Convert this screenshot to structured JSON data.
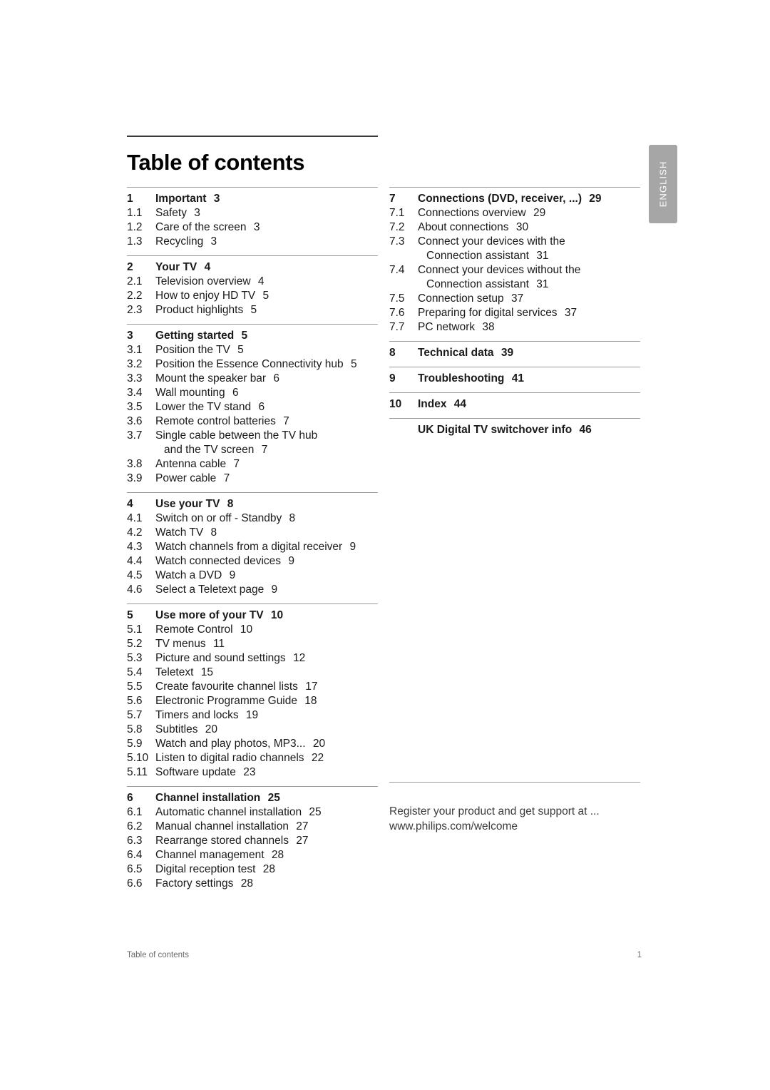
{
  "document": {
    "title": "Table of contents",
    "language_tab": "ENGLISH"
  },
  "footer": {
    "left": "Table of contents",
    "page_number": "1"
  },
  "register": {
    "line1": "Register your product and get support at ...",
    "line2": "www.philips.com/welcome"
  },
  "toc": {
    "left_column": [
      {
        "entries": [
          {
            "num": "1",
            "text": "Important",
            "page": "3",
            "head": true
          },
          {
            "num": "1.1",
            "text": "Safety",
            "page": "3"
          },
          {
            "num": "1.2",
            "text": "Care of the screen",
            "page": "3"
          },
          {
            "num": "1.3",
            "text": "Recycling",
            "page": "3"
          }
        ]
      },
      {
        "entries": [
          {
            "num": "2",
            "text": "Your TV",
            "page": "4",
            "head": true
          },
          {
            "num": "2.1",
            "text": "Television overview",
            "page": "4"
          },
          {
            "num": "2.2",
            "text": "How to enjoy HD TV",
            "page": "5"
          },
          {
            "num": "2.3",
            "text": "Product highlights",
            "page": "5"
          }
        ]
      },
      {
        "entries": [
          {
            "num": "3",
            "text": "Getting started",
            "page": "5",
            "head": true
          },
          {
            "num": "3.1",
            "text": "Position the TV",
            "page": "5"
          },
          {
            "num": "3.2",
            "text": "Position the Essence Connectivity hub",
            "page": "5"
          },
          {
            "num": "3.3",
            "text": "Mount the speaker bar",
            "page": "6"
          },
          {
            "num": "3.4",
            "text": "Wall mounting",
            "page": "6"
          },
          {
            "num": "3.5",
            "text": "Lower the TV stand",
            "page": "6"
          },
          {
            "num": "3.6",
            "text": "Remote control batteries",
            "page": "7"
          },
          {
            "num": "3.7",
            "text": "Single cable between the TV hub",
            "page": ""
          },
          {
            "num": "",
            "text": "and the TV screen",
            "page": "7",
            "cont": true
          },
          {
            "num": "3.8",
            "text": "Antenna cable",
            "page": "7"
          },
          {
            "num": "3.9",
            "text": "Power cable",
            "page": "7"
          }
        ]
      },
      {
        "entries": [
          {
            "num": "4",
            "text": "Use your TV",
            "page": "8",
            "head": true
          },
          {
            "num": "4.1",
            "text": "Switch on or off - Standby",
            "page": "8"
          },
          {
            "num": "4.2",
            "text": "Watch TV",
            "page": "8"
          },
          {
            "num": "4.3",
            "text": "Watch channels from a digital receiver",
            "page": "9"
          },
          {
            "num": "4.4",
            "text": "Watch connected devices",
            "page": "9"
          },
          {
            "num": "4.5",
            "text": "Watch a DVD",
            "page": "9"
          },
          {
            "num": "4.6",
            "text": "Select a Teletext page",
            "page": "9"
          }
        ]
      },
      {
        "entries": [
          {
            "num": "5",
            "text": "Use more of your TV",
            "page": "10",
            "head": true
          },
          {
            "num": "5.1",
            "text": "Remote Control",
            "page": "10"
          },
          {
            "num": "5.2",
            "text": "TV menus",
            "page": "11"
          },
          {
            "num": "5.3",
            "text": "Picture and sound settings",
            "page": "12"
          },
          {
            "num": "5.4",
            "text": "Teletext",
            "page": "15"
          },
          {
            "num": "5.5",
            "text": "Create favourite channel lists",
            "page": "17"
          },
          {
            "num": "5.6",
            "text": "Electronic Programme Guide",
            "page": "18"
          },
          {
            "num": "5.7",
            "text": "Timers and locks",
            "page": "19"
          },
          {
            "num": "5.8",
            "text": "Subtitles",
            "page": "20"
          },
          {
            "num": "5.9",
            "text": "Watch and play photos, MP3...",
            "page": "20"
          },
          {
            "num": "5.10",
            "text": "Listen to digital radio channels",
            "page": "22"
          },
          {
            "num": "5.11",
            "text": "Software update",
            "page": "23"
          }
        ]
      },
      {
        "entries": [
          {
            "num": "6",
            "text": "Channel installation",
            "page": "25",
            "head": true
          },
          {
            "num": "6.1",
            "text": "Automatic channel installation",
            "page": "25"
          },
          {
            "num": "6.2",
            "text": "Manual channel installation",
            "page": "27"
          },
          {
            "num": "6.3",
            "text": "Rearrange stored channels",
            "page": "27"
          },
          {
            "num": "6.4",
            "text": "Channel management",
            "page": "28"
          },
          {
            "num": "6.5",
            "text": "Digital reception test",
            "page": "28"
          },
          {
            "num": "6.6",
            "text": "Factory settings",
            "page": "28"
          }
        ]
      }
    ],
    "right_column": [
      {
        "entries": [
          {
            "num": "7",
            "text": "Connections (DVD, receiver, ...)",
            "page": "29",
            "head": true
          },
          {
            "num": "7.1",
            "text": "Connections overview",
            "page": "29"
          },
          {
            "num": "7.2",
            "text": "About connections",
            "page": "30"
          },
          {
            "num": "7.3",
            "text": "Connect your devices with the",
            "page": ""
          },
          {
            "num": "",
            "text": "Connection assistant",
            "page": "31",
            "cont": true
          },
          {
            "num": "7.4",
            "text": "Connect your devices without the",
            "page": ""
          },
          {
            "num": "",
            "text": "Connection assistant",
            "page": "31",
            "cont": true
          },
          {
            "num": "7.5",
            "text": "Connection setup",
            "page": "37"
          },
          {
            "num": "7.6",
            "text": "Preparing for digital services",
            "page": "37"
          },
          {
            "num": "7.7",
            "text": "PC network",
            "page": "38"
          }
        ]
      },
      {
        "entries": [
          {
            "num": "8",
            "text": "Technical data",
            "page": "39",
            "head": true
          }
        ]
      },
      {
        "entries": [
          {
            "num": "9",
            "text": "Troubleshooting",
            "page": "41",
            "head": true
          }
        ]
      },
      {
        "entries": [
          {
            "num": "10",
            "text": "Index",
            "page": "44",
            "head": true
          }
        ]
      },
      {
        "entries": [
          {
            "num": "",
            "text": "UK Digital TV switchover info",
            "page": "46",
            "head": true,
            "noNum": true
          }
        ]
      }
    ]
  }
}
